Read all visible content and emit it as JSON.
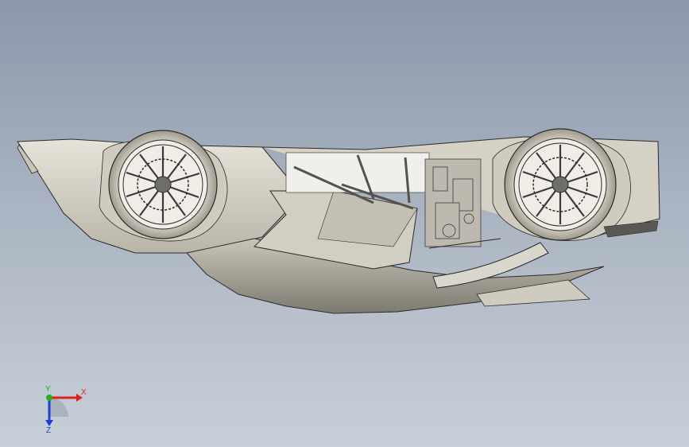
{
  "viewport": {
    "model_name": "",
    "background_top": "#8b98aa",
    "background_bottom": "#c8cfd8"
  },
  "model": {
    "body_color": "#d9d5c9",
    "shadow_color": "#8d8a7e",
    "edge_color": "#2a2a2a"
  },
  "triad": {
    "x_label": "X",
    "y_label": "Y",
    "z_label": "Z",
    "x_color": "#e02020",
    "y_color": "#20b020",
    "z_color": "#2040d0"
  }
}
